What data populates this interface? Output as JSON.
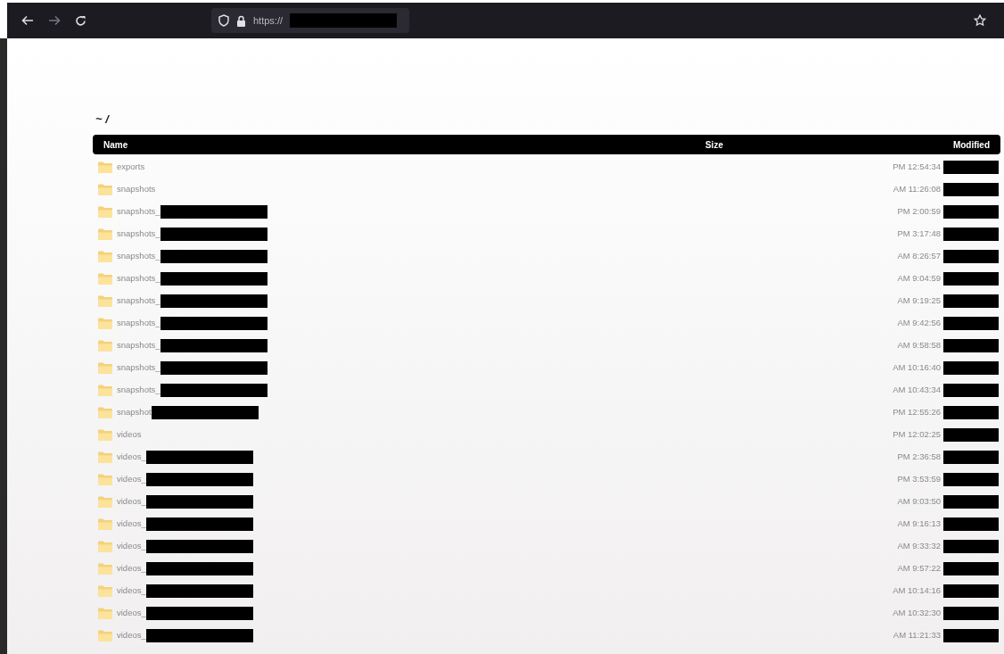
{
  "browser": {
    "url": "https://",
    "url_redacted": true
  },
  "page": {
    "path": "~ /"
  },
  "table": {
    "columns": [
      "Name",
      "Size",
      "Modified"
    ],
    "rows": [
      {
        "name": "exports",
        "name_redacted": false,
        "modified": "PM 12:54:34"
      },
      {
        "name": "snapshots",
        "name_redacted": false,
        "modified": "AM 11:26:08"
      },
      {
        "name": "snapshots_",
        "name_redacted": true,
        "modified": "PM 2:00:59"
      },
      {
        "name": "snapshots_",
        "name_redacted": true,
        "modified": "PM 3:17:48"
      },
      {
        "name": "snapshots_",
        "name_redacted": true,
        "modified": "AM 8:26:57"
      },
      {
        "name": "snapshots_",
        "name_redacted": true,
        "modified": "AM 9:04:59"
      },
      {
        "name": "snapshots_",
        "name_redacted": true,
        "modified": "AM 9:19:25"
      },
      {
        "name": "snapshots_",
        "name_redacted": true,
        "modified": "AM 9:42:56"
      },
      {
        "name": "snapshots_",
        "name_redacted": true,
        "modified": "AM 9:58:58"
      },
      {
        "name": "snapshots_",
        "name_redacted": true,
        "modified": "AM 10:16:40"
      },
      {
        "name": "snapshots_",
        "name_redacted": true,
        "modified": "AM 10:43:34"
      },
      {
        "name": "snapshot",
        "name_redacted": true,
        "modified": "PM 12:55:26"
      },
      {
        "name": "videos",
        "name_redacted": false,
        "modified": "PM 12:02:25"
      },
      {
        "name": "videos_",
        "name_redacted": true,
        "modified": "PM 2:36:58"
      },
      {
        "name": "videos_",
        "name_redacted": true,
        "modified": "PM 3:53:59"
      },
      {
        "name": "videos_",
        "name_redacted": true,
        "modified": "AM 9:03:50"
      },
      {
        "name": "videos_",
        "name_redacted": true,
        "modified": "AM 9:16:13"
      },
      {
        "name": "videos_",
        "name_redacted": true,
        "modified": "AM 9:33:32"
      },
      {
        "name": "videos_",
        "name_redacted": true,
        "modified": "AM 9:57:22"
      },
      {
        "name": "videos_",
        "name_redacted": true,
        "modified": "AM 10:14:16"
      },
      {
        "name": "videos_",
        "name_redacted": true,
        "modified": "AM 10:32:30"
      },
      {
        "name": "videos_",
        "name_redacted": true,
        "modified": "AM 11:21:33"
      }
    ]
  }
}
